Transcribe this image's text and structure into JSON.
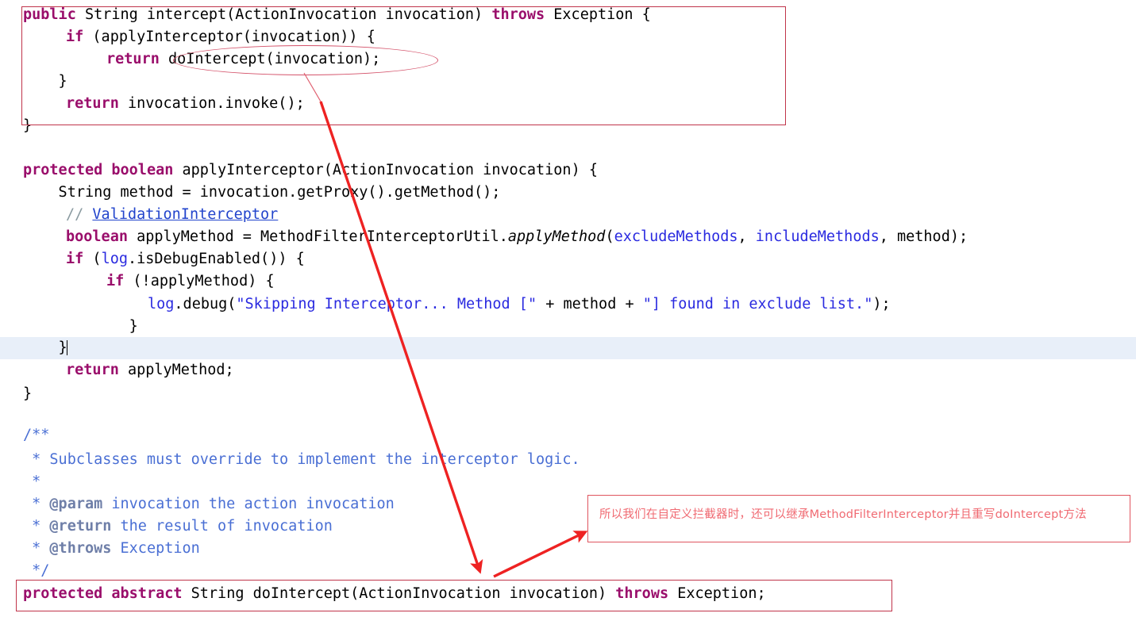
{
  "editor": {
    "language": "java",
    "background": "#ffffff",
    "current_line_highlight_color": "#e8eff9",
    "keyword_color": "#9a0e6b",
    "string_color": "#2a2ae0",
    "comment_color": "#8a9aa0",
    "javadoc_color": "#4a6fd4",
    "lines": {
      "l1_public": "public",
      "l1_rest": " String intercept(ActionInvocation invocation) ",
      "l1_throws": "throws",
      "l1_tail": " Exception {",
      "l2_if": "if",
      "l2_rest": " (applyInterceptor(invocation)) {",
      "l3_return": "return",
      "l3_rest": " doIntercept(invocation);",
      "l4": "    }",
      "l5_return": "return",
      "l5_rest": " invocation.invoke();",
      "l6": "}",
      "l8_protected": "protected",
      "l8_boolean": "boolean",
      "l8_rest": " applyInterceptor(ActionInvocation invocation) {",
      "l9": "    String method = invocation.getProxy().getMethod();",
      "l10_comment": "// ",
      "l10_link": "ValidationInterceptor",
      "l11_boolean": "boolean",
      "l11_mid": " applyMethod = MethodFilterInterceptorUtil.",
      "l11_italic": "applyMethod",
      "l11_paren": "(",
      "l11_fld1": "excludeMethods",
      "l11_sep": ", ",
      "l11_fld2": "includeMethods",
      "l11_tail": ", method);",
      "l12_if": "if",
      "l12_open": " (",
      "l12_log": "log",
      "l12_rest": ".isDebugEnabled()) {",
      "l13_if": "if",
      "l13_rest": " (!applyMethod) {",
      "l14_log": "log",
      "l14_dot": ".debug(",
      "l14_str1": "\"Skipping Interceptor... Method [\"",
      "l14_plus1": " + method + ",
      "l14_str2": "\"] found in exclude list.\"",
      "l14_tail": ");",
      "l15": "            }",
      "l16": "    }",
      "l17_return": "return",
      "l17_rest": " applyMethod;",
      "l18": "}",
      "l20": "/**",
      "l21": " * Subclasses must override to implement the interceptor logic.",
      "l22": " *",
      "l23_star": " * ",
      "l23_tag": "@param",
      "l23_rest": " invocation the action invocation",
      "l24_tag": "@return",
      "l24_rest": " the result of invocation",
      "l25_tag": "@throws",
      "l25_rest": " Exception",
      "l26": " */",
      "l27_protected": "protected",
      "l27_abstract": "abstract",
      "l27_mid": " String doIntercept(ActionInvocation invocation) ",
      "l27_throws": "throws",
      "l27_tail": " Exception;"
    }
  },
  "annotations": {
    "rect_color": "#c0344a",
    "ellipse_color": "#d4526a",
    "arrow_color": "#ee2222",
    "note_border_color": "#e0555f",
    "note_text_color": "#f06a72",
    "top_box_label": "intercept-method-highlight-box",
    "bottom_box_label": "dointercept-declaration-highlight-box",
    "ellipse_label": "dointercept-call-ellipse",
    "note_text": "所以我们在自定义拦截器时，还可以继承MethodFilterInterceptor并且重写doIntercept方法"
  }
}
